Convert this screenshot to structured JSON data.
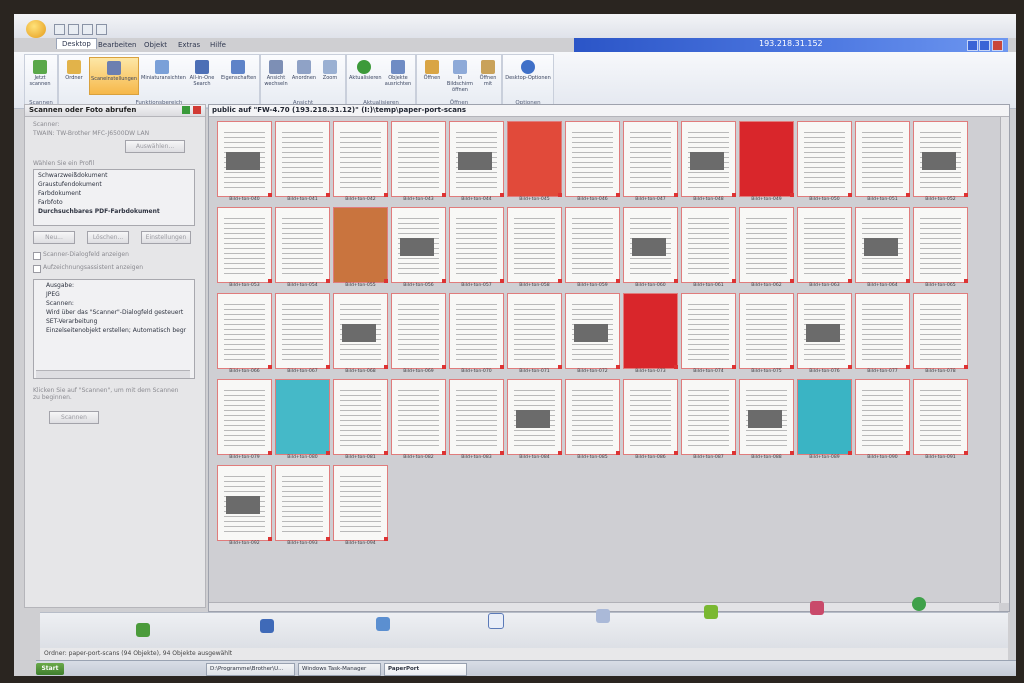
{
  "titlebar": {
    "host": "193.218.31.152"
  },
  "menu": {
    "tabs": [
      "Desktop",
      "Bearbeiten",
      "Objekt",
      "Extras",
      "Hilfe"
    ]
  },
  "ribbon": {
    "buttons": [
      "Jetzt scannen",
      "Ordner",
      "Scaneinstellungen",
      "Miniaturansichten",
      "All-in-One Search",
      "Eigenschaften",
      "Ansicht wechseln",
      "Anordnen",
      "Zoom",
      "Aktualisieren",
      "Objekte ausrichten",
      "Öffnen",
      "In Bildschirm öffnen",
      "Öffnen mit",
      "Desktop-Optionen"
    ],
    "groups": [
      "Scannen",
      "Funktionsbereich",
      "Ansicht",
      "Aktualisieren",
      "Öffnen",
      "Optionen"
    ]
  },
  "left_panel": {
    "title": "Scannen oder Foto abrufen",
    "scanner_label": "Scanner:",
    "scanner_value": "TWAIN: TW-Brother MFC-J6500DW LAN",
    "select_button": "Auswählen...",
    "profile_label": "Wählen Sie ein Profil",
    "profiles": [
      "Schwarzweißdokument",
      "Graustufendokument",
      "Farbdokument",
      "Farbfoto",
      "Durchsuchbares PDF-Farbdokument"
    ],
    "profile_buttons": [
      "Neu...",
      "Löschen...",
      "Einstellungen"
    ],
    "checkboxes": [
      "Scanner-Dialogfeld anzeigen",
      "Aufzeichnungsassistent anzeigen"
    ],
    "output": [
      "Ausgabe:",
      "JPEG",
      "Scannen:",
      "Wird über das \"Scanner\"-Dialogfeld gesteuert",
      "SET-Verarbeitung",
      "Einzelseitenobjekt erstellen; Automatisch begr"
    ],
    "hint": "Klicken Sie auf \"Scannen\", um mit dem Scannen zu beginnen.",
    "scan_button": "Scannen"
  },
  "main": {
    "path": "public auf \"FW-4.70 (193.218.31.12)\" (I:)\\temp\\paper-port-scans",
    "thumbs": [
      "Bild+ton-040",
      "Bild+ton-041",
      "Bild+ton-042",
      "Bild+ton-043",
      "Bild+ton-044",
      "Bild+ton-045",
      "Bild+ton-046",
      "Bild+ton-047",
      "Bild+ton-048",
      "Bild+ton-049",
      "Bild+ton-050",
      "Bild+ton-051",
      "Bild+ton-052",
      "Bild+ton-053",
      "Bild+ton-054",
      "Bild+ton-055",
      "Bild+ton-056",
      "Bild+ton-057",
      "Bild+ton-058",
      "Bild+ton-059",
      "Bild+ton-060",
      "Bild+ton-061",
      "Bild+ton-062",
      "Bild+ton-063",
      "Bild+ton-064",
      "Bild+ton-065",
      "Bild+ton-066",
      "Bild+ton-067",
      "Bild+ton-068",
      "Bild+ton-069",
      "Bild+ton-070",
      "Bild+ton-071",
      "Bild+ton-072",
      "Bild+ton-073",
      "Bild+ton-074",
      "Bild+ton-075",
      "Bild+ton-076",
      "Bild+ton-077",
      "Bild+ton-078",
      "Bild+ton-079",
      "Bild+ton-080",
      "Bild+ton-081",
      "Bild+ton-082",
      "Bild+ton-083",
      "Bild+ton-084",
      "Bild+ton-085",
      "Bild+ton-086",
      "Bild+ton-087",
      "Bild+ton-088",
      "Bild+ton-089",
      "Bild+ton-090",
      "Bild+ton-091",
      "Bild+ton-092",
      "Bild+ton-093",
      "Bild+ton-094"
    ]
  },
  "bottombar": {
    "icons": [
      "scanner-icon",
      "edit-icon",
      "note-icon",
      "ftp-icon",
      "fax-icon",
      "shape-icon",
      "people-icon",
      "globe-icon"
    ]
  },
  "status": {
    "text": "Ordner: paper-port-scans (94 Objekte), 94 Objekte ausgewählt"
  },
  "taskbar": {
    "start": "Start",
    "tasks": [
      "D:\\Programme\\Brother\\U...",
      "Windows Task-Manager",
      "PaperPort"
    ]
  },
  "colors": {
    "accent": "#f6b84a",
    "titlebar_blue": "#2b55c7",
    "page_border": "#e07c7c"
  }
}
